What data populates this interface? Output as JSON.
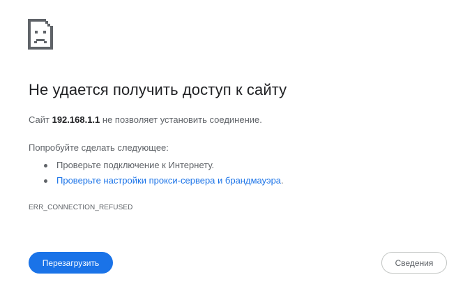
{
  "icon": "sad-page-icon",
  "heading": "Не удается получить доступ к сайту",
  "summary": {
    "prefix": "Сайт ",
    "host": "192.168.1.1",
    "suffix": " не позволяет установить соединение."
  },
  "suggestions": {
    "title": "Попробуйте сделать следующее:",
    "items": [
      {
        "text": "Проверьте подключение к Интернету.",
        "link_text": "",
        "trail": ""
      },
      {
        "text": "",
        "link_text": "Проверьте настройки прокси-сервера и брандмауэра",
        "trail": "."
      }
    ]
  },
  "error_code": "ERR_CONNECTION_REFUSED",
  "buttons": {
    "reload": "Перезагрузить",
    "details": "Сведения"
  },
  "colors": {
    "accent": "#1a73e8",
    "text_primary": "#202124",
    "text_secondary": "#5f6368"
  }
}
